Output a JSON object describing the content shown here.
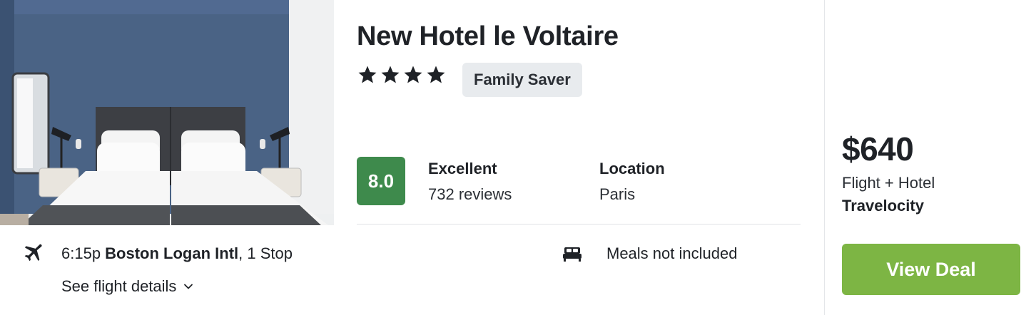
{
  "photo": {
    "alt_name": "hotel-room-photo"
  },
  "hotel": {
    "name": "New Hotel le Voltaire",
    "star_rating": 4,
    "badge": "Family Saver"
  },
  "review": {
    "score": "8.0",
    "label": "Excellent",
    "count": "732 reviews",
    "score_color": "#3e8a4c"
  },
  "location": {
    "label": "Location",
    "value": "Paris"
  },
  "flight": {
    "icon": "airplane-icon",
    "time": "6:15p",
    "airport": "Boston Logan Intl",
    "stops": ", 1 Stop",
    "details_link": "See flight details"
  },
  "amenities": {
    "icon": "bed-icon",
    "meals": "Meals not included"
  },
  "deal": {
    "price": "$640",
    "package": "Flight + Hotel",
    "provider": "Travelocity",
    "button_label": "View Deal",
    "button_color": "#7db544"
  }
}
